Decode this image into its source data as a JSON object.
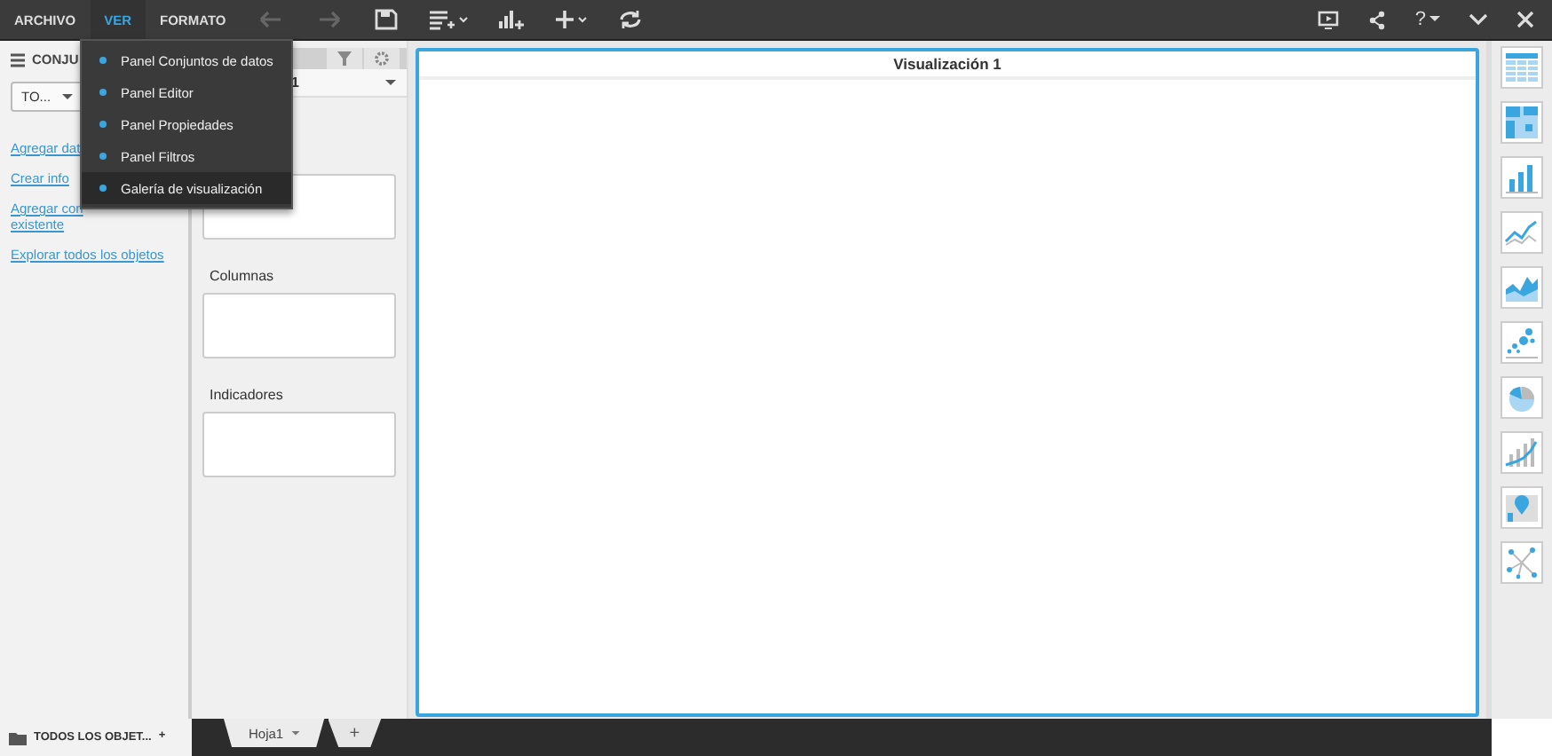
{
  "menus": [
    {
      "label": "ARCHIVO",
      "selected": false
    },
    {
      "label": "VER",
      "selected": true
    },
    {
      "label": "FORMATO",
      "selected": false
    }
  ],
  "toolbar": [
    {
      "kind": "undo",
      "disabled": true
    },
    {
      "kind": "redo",
      "disabled": true
    },
    {
      "kind": "save",
      "disabled": false
    },
    {
      "kind": "dataset",
      "disabled": false
    },
    {
      "kind": "chart",
      "disabled": false
    },
    {
      "kind": "add",
      "disabled": false
    },
    {
      "kind": "refresh",
      "disabled": false
    }
  ],
  "help_label": "?",
  "view_menu": {
    "items": [
      {
        "label": "Panel Conjuntos de datos",
        "selected": false
      },
      {
        "label": "Panel Editor",
        "selected": false
      },
      {
        "label": "Panel Propiedades",
        "selected": false
      },
      {
        "label": "Panel Filtros",
        "selected": false
      },
      {
        "label": "Galería de visualización",
        "selected": true
      }
    ]
  },
  "datasets_panel": {
    "title": "CONJU",
    "filter": "TO...",
    "links": [
      {
        "lines": [
          "Agregar dat"
        ]
      },
      {
        "lines": [
          "Crear info"
        ]
      },
      {
        "lines": [
          "Agregar con",
          "existente"
        ]
      },
      {
        "lines": [
          "Explorar todos los objetos"
        ]
      }
    ]
  },
  "editor_panel": {
    "selector": "1",
    "zones": [
      {
        "label": "Columnas"
      },
      {
        "label": "Indicadores"
      }
    ]
  },
  "canvas": {
    "title": "Visualización 1"
  },
  "gallery": [
    {
      "kind": "table"
    },
    {
      "kind": "crosstab"
    },
    {
      "kind": "bar"
    },
    {
      "kind": "line"
    },
    {
      "kind": "area"
    },
    {
      "kind": "scatter"
    },
    {
      "kind": "pie"
    },
    {
      "kind": "combo"
    },
    {
      "kind": "map"
    },
    {
      "kind": "network"
    }
  ],
  "bottom": {
    "objects_label": "TODOS LOS OBJET...",
    "add_label": "+",
    "sheets": [
      {
        "label": "Hoja1",
        "selected": true
      }
    ],
    "add_sheet": "+"
  }
}
